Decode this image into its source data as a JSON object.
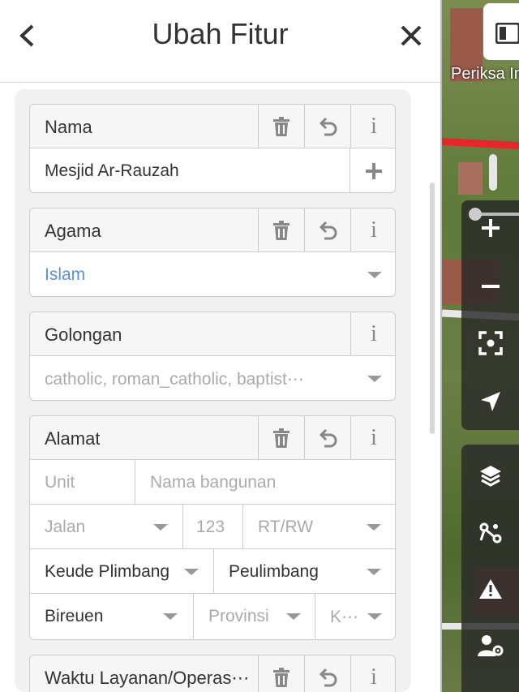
{
  "header": {
    "title": "Ubah Fitur",
    "back_icon": "chevron-left-icon",
    "close_icon": "close-icon"
  },
  "fields": {
    "nama": {
      "label": "Nama",
      "value": "Mesjid Ar-Rauzah"
    },
    "agama": {
      "label": "Agama",
      "value": "Islam"
    },
    "golongan": {
      "label": "Golongan",
      "placeholder": "catholic, roman_catholic, baptist⋯"
    },
    "alamat": {
      "label": "Alamat",
      "unit_placeholder": "Unit",
      "building_placeholder": "Nama bangunan",
      "street_placeholder": "Jalan",
      "housenumber_placeholder": "123",
      "rtrw_placeholder": "RT/RW",
      "village_value": "Keude Plimbang",
      "district_value": "Peulimbang",
      "city_value": "Bireuen",
      "province_placeholder": "Provinsi",
      "postcode_placeholder": "K⋯"
    },
    "waktu": {
      "label": "Waktu Layanan/Operas⋯"
    }
  },
  "map": {
    "top_button_label": "Periksa In",
    "controls": [
      "zoom-in-icon",
      "zoom-out-icon",
      "locate-icon",
      "navigate-icon",
      "layers-icon",
      "edit-nodes-icon",
      "warning-icon",
      "user-settings-icon"
    ]
  },
  "colors": {
    "link": "#5b90d6",
    "road_highlight": "#e6262a"
  }
}
